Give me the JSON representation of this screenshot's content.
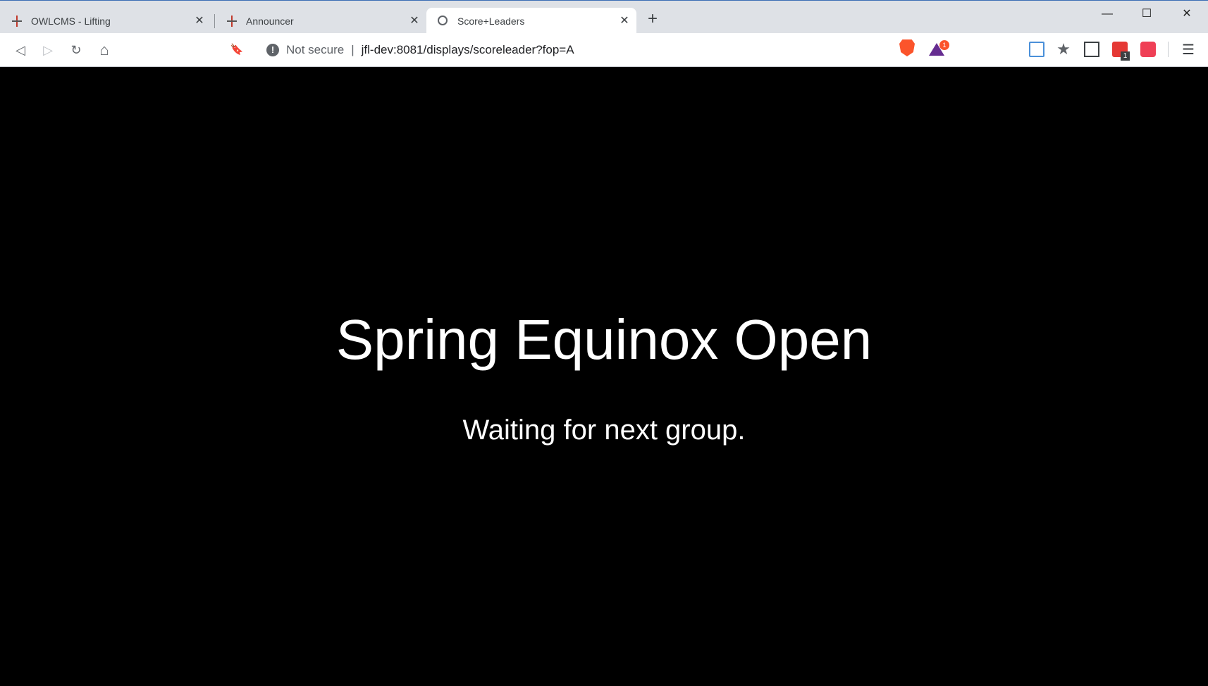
{
  "tabs": [
    {
      "title": "OWLCMS - Lifting",
      "favicon": "owlcms-icon",
      "active": false
    },
    {
      "title": "Announcer",
      "favicon": "owlcms-icon",
      "active": false
    },
    {
      "title": "Score+Leaders",
      "favicon": "globe-icon",
      "active": true
    }
  ],
  "tab_close_glyph": "✕",
  "new_tab_glyph": "+",
  "window_controls": {
    "minimize": "—",
    "maximize": "☐",
    "close": "✕"
  },
  "toolbar": {
    "back": "◁",
    "forward": "▷",
    "reload": "↻",
    "home": "⌂",
    "bookmark": "🔖",
    "security_label": "Not secure",
    "url": "jfl-dev:8081/displays/scoreleader?fop=A",
    "rewards_badge": "1",
    "extension_badge": "1",
    "menu": "☰"
  },
  "page": {
    "competition_name": "Spring Equinox Open",
    "status_message": "Waiting for next group."
  },
  "colors": {
    "background": "#000000",
    "text": "#ffffff",
    "tabstrip": "#dee1e6"
  }
}
